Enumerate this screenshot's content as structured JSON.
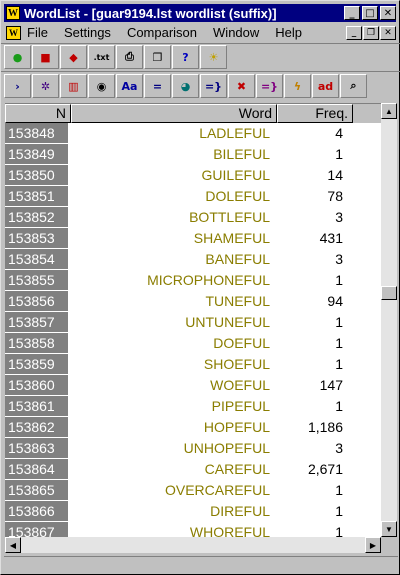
{
  "window": {
    "title": "WordList - [guar9194.lst wordlist  (suffix)]",
    "app_icon": "W"
  },
  "menu": {
    "items": [
      "File",
      "Settings",
      "Comparison",
      "Window",
      "Help"
    ]
  },
  "toolbar1": [
    {
      "name": "open-icon",
      "glyph": "●",
      "color": "#1a9c1a"
    },
    {
      "name": "save-icon",
      "glyph": "■",
      "color": "#c00000"
    },
    {
      "name": "print-file-icon",
      "glyph": "◆",
      "color": "#c00000"
    },
    {
      "name": "txt-icon",
      "glyph": ".txt",
      "color": "#000000"
    },
    {
      "name": "printer-icon",
      "glyph": "⎙",
      "color": "#000000"
    },
    {
      "name": "copy-icon",
      "glyph": "❐",
      "color": "#000000"
    },
    {
      "name": "help-icon",
      "glyph": "?",
      "color": "#0000c0"
    },
    {
      "name": "lightbulb-icon",
      "glyph": "☀",
      "color": "#c0a000"
    }
  ],
  "toolbar2": [
    {
      "name": "arrow-right-icon",
      "glyph": "›",
      "color": "#000080"
    },
    {
      "name": "gear-icon",
      "glyph": "✲",
      "color": "#400080"
    },
    {
      "name": "columns-icon",
      "glyph": "▥",
      "color": "#c00000"
    },
    {
      "name": "eye-icon",
      "glyph": "◉",
      "color": "#000000"
    },
    {
      "name": "font-icon",
      "glyph": "Aa",
      "color": "#0000a0"
    },
    {
      "name": "equals-icon",
      "glyph": "=",
      "color": "#000080"
    },
    {
      "name": "globe-icon",
      "glyph": "◕",
      "color": "#007070"
    },
    {
      "name": "join-icon",
      "glyph": "=}",
      "color": "#000080"
    },
    {
      "name": "delete-icon",
      "glyph": "✖",
      "color": "#c00000"
    },
    {
      "name": "join-arrow-icon",
      "glyph": "=}",
      "color": "#800080"
    },
    {
      "name": "zap-icon",
      "glyph": "ϟ",
      "color": "#c08000"
    },
    {
      "name": "ad-icon",
      "glyph": "ad",
      "color": "#c00000"
    },
    {
      "name": "zoom-icon",
      "glyph": "⌕",
      "color": "#000000"
    }
  ],
  "table": {
    "headers": {
      "n": "N",
      "word": "Word",
      "freq": "Freq."
    },
    "rows": [
      {
        "n": "153848",
        "word": "LADLEFUL",
        "freq": "4"
      },
      {
        "n": "153849",
        "word": "BILEFUL",
        "freq": "1"
      },
      {
        "n": "153850",
        "word": "GUILEFUL",
        "freq": "14"
      },
      {
        "n": "153851",
        "word": "DOLEFUL",
        "freq": "78"
      },
      {
        "n": "153852",
        "word": "BOTTLEFUL",
        "freq": "3"
      },
      {
        "n": "153853",
        "word": "SHAMEFUL",
        "freq": "431"
      },
      {
        "n": "153854",
        "word": "BANEFUL",
        "freq": "3"
      },
      {
        "n": "153855",
        "word": "MICROPHONEFUL",
        "freq": "1"
      },
      {
        "n": "153856",
        "word": "TUNEFUL",
        "freq": "94"
      },
      {
        "n": "153857",
        "word": "UNTUNEFUL",
        "freq": "1"
      },
      {
        "n": "153858",
        "word": "DOEFUL",
        "freq": "1"
      },
      {
        "n": "153859",
        "word": "SHOEFUL",
        "freq": "1"
      },
      {
        "n": "153860",
        "word": "WOEFUL",
        "freq": "147"
      },
      {
        "n": "153861",
        "word": "PIPEFUL",
        "freq": "1"
      },
      {
        "n": "153862",
        "word": "HOPEFUL",
        "freq": "1,186"
      },
      {
        "n": "153863",
        "word": "UNHOPEFUL",
        "freq": "3"
      },
      {
        "n": "153864",
        "word": "CAREFUL",
        "freq": "2,671"
      },
      {
        "n": "153865",
        "word": "OVERCAREFUL",
        "freq": "1"
      },
      {
        "n": "153866",
        "word": "DIREFUL",
        "freq": "1"
      },
      {
        "n": "153867",
        "word": "WHOREFUL",
        "freq": "1"
      }
    ]
  },
  "scrollbar": {
    "position": 0.43
  }
}
